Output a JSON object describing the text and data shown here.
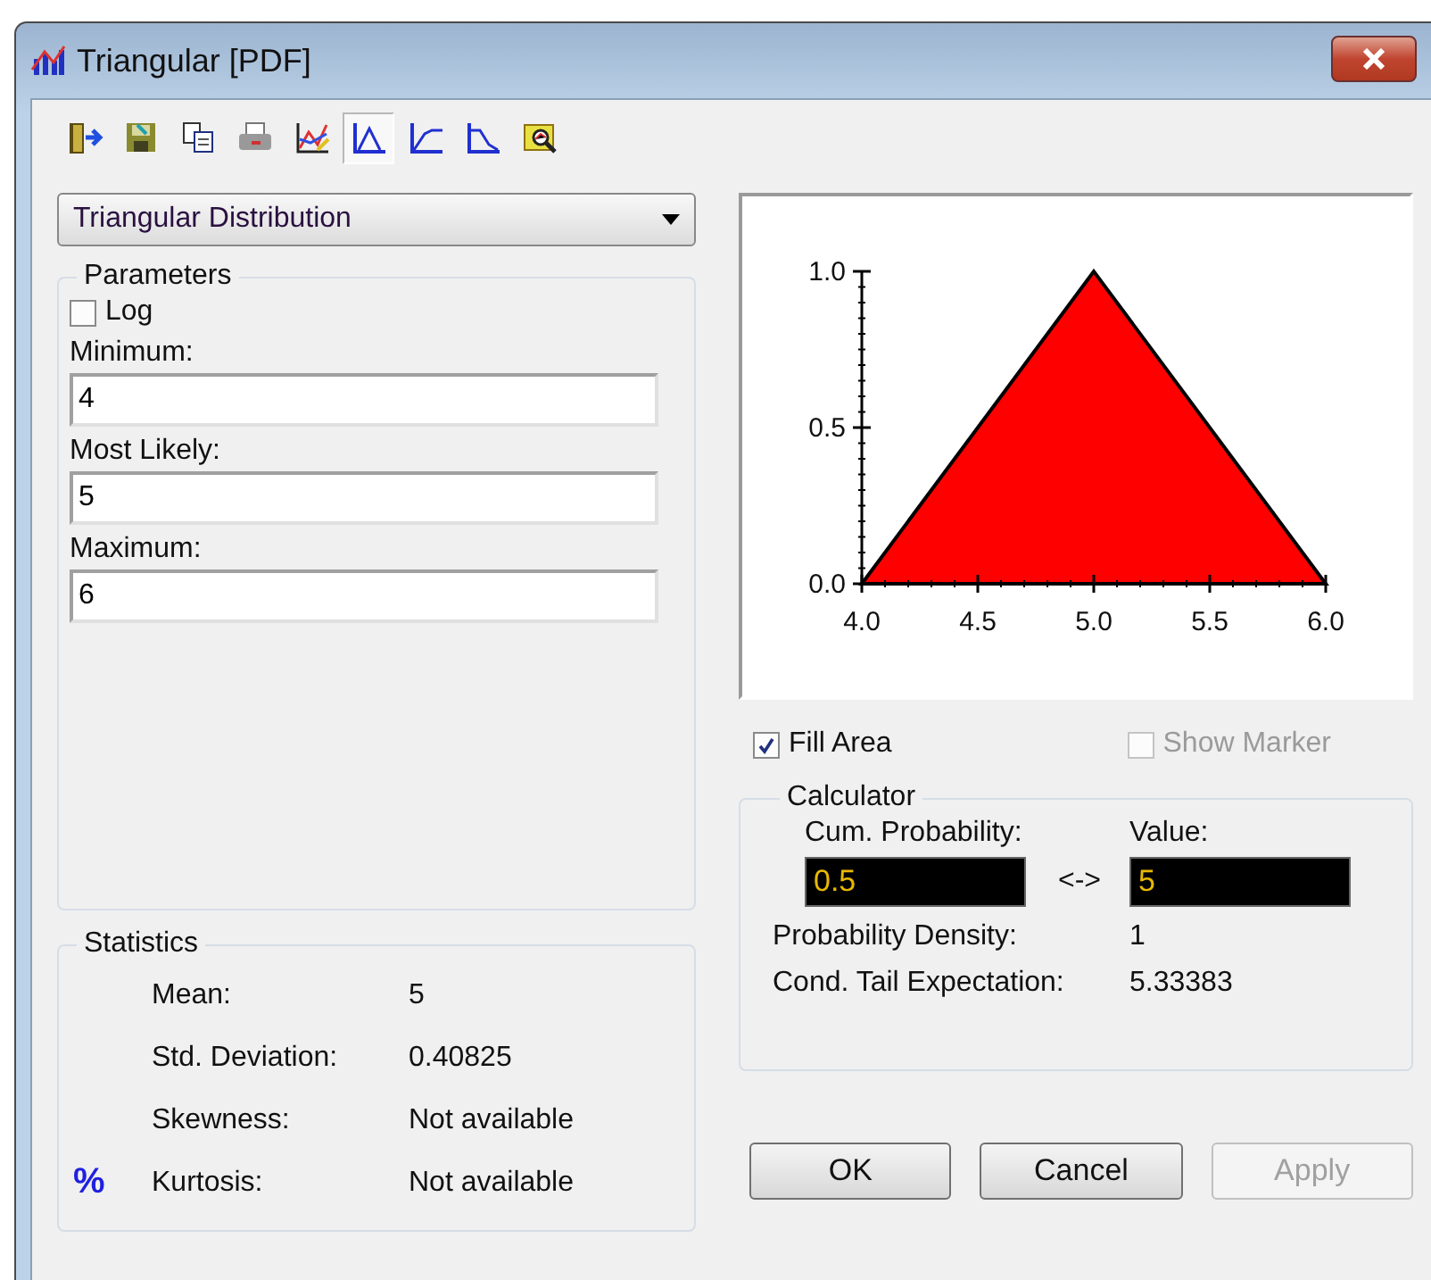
{
  "window": {
    "title": "Triangular [PDF]"
  },
  "toolbar": [
    {
      "kind": "exit",
      "selected": false
    },
    {
      "kind": "save",
      "selected": false
    },
    {
      "kind": "copy",
      "selected": false
    },
    {
      "kind": "print",
      "selected": false
    },
    {
      "kind": "overlay",
      "selected": false
    },
    {
      "kind": "pdf",
      "selected": true
    },
    {
      "kind": "cdf",
      "selected": false
    },
    {
      "kind": "rcdf",
      "selected": false
    },
    {
      "kind": "zoom",
      "selected": false
    }
  ],
  "distribution": {
    "value": "Triangular Distribution"
  },
  "parameters": {
    "title": "Parameters",
    "log": {
      "label": "Log",
      "checked": false
    },
    "fields": [
      {
        "label": "Minimum:",
        "value": "4"
      },
      {
        "label": "Most Likely:",
        "value": "5"
      },
      {
        "label": "Maximum:",
        "value": "6"
      }
    ]
  },
  "statistics": {
    "title": "Statistics",
    "menu_glyph": "%",
    "rows": [
      {
        "label": "Mean:",
        "value": "5"
      },
      {
        "label": "Std. Deviation:",
        "value": "0.40825"
      },
      {
        "label": "Skewness:",
        "value": "Not available"
      },
      {
        "label": "Kurtosis:",
        "value": "Not available"
      }
    ]
  },
  "chart": {
    "chart_data": {
      "type": "area",
      "x": [
        4,
        5,
        6
      ],
      "series": [
        {
          "color": "#ff0000",
          "values": [
            0,
            1,
            0
          ]
        }
      ],
      "xlim": [
        4,
        6
      ],
      "ylim": [
        0,
        1
      ],
      "xticks": [
        {
          "value": 4,
          "label": "4.0"
        },
        {
          "value": 4.5,
          "label": "4.5"
        },
        {
          "value": 5,
          "label": "5.0"
        },
        {
          "value": 5.5,
          "label": "5.5"
        },
        {
          "value": 6,
          "label": "6.0"
        }
      ],
      "yticks": [
        {
          "value": 0,
          "label": "0.0"
        },
        {
          "value": 0.5,
          "label": "0.5"
        },
        {
          "value": 1,
          "label": "1.0"
        }
      ]
    }
  },
  "fill_area": {
    "label": "Fill Area",
    "checked": true,
    "disabled": false
  },
  "show_marker": {
    "label": "Show Marker",
    "checked": false,
    "disabled": true
  },
  "calculator": {
    "title": "Calculator",
    "prob_label": "Cum. Probability:",
    "prob_value": "0.5",
    "link": "<->",
    "value_label": "Value:",
    "value_value": "5",
    "rows": [
      {
        "label": "Probability Density:",
        "value": "1"
      },
      {
        "label": "Cond. Tail Expectation:",
        "value": "5.33383"
      }
    ]
  },
  "buttons": [
    {
      "label": "OK",
      "disabled": false
    },
    {
      "label": "Cancel",
      "disabled": false
    },
    {
      "label": "Apply",
      "disabled": true
    }
  ]
}
